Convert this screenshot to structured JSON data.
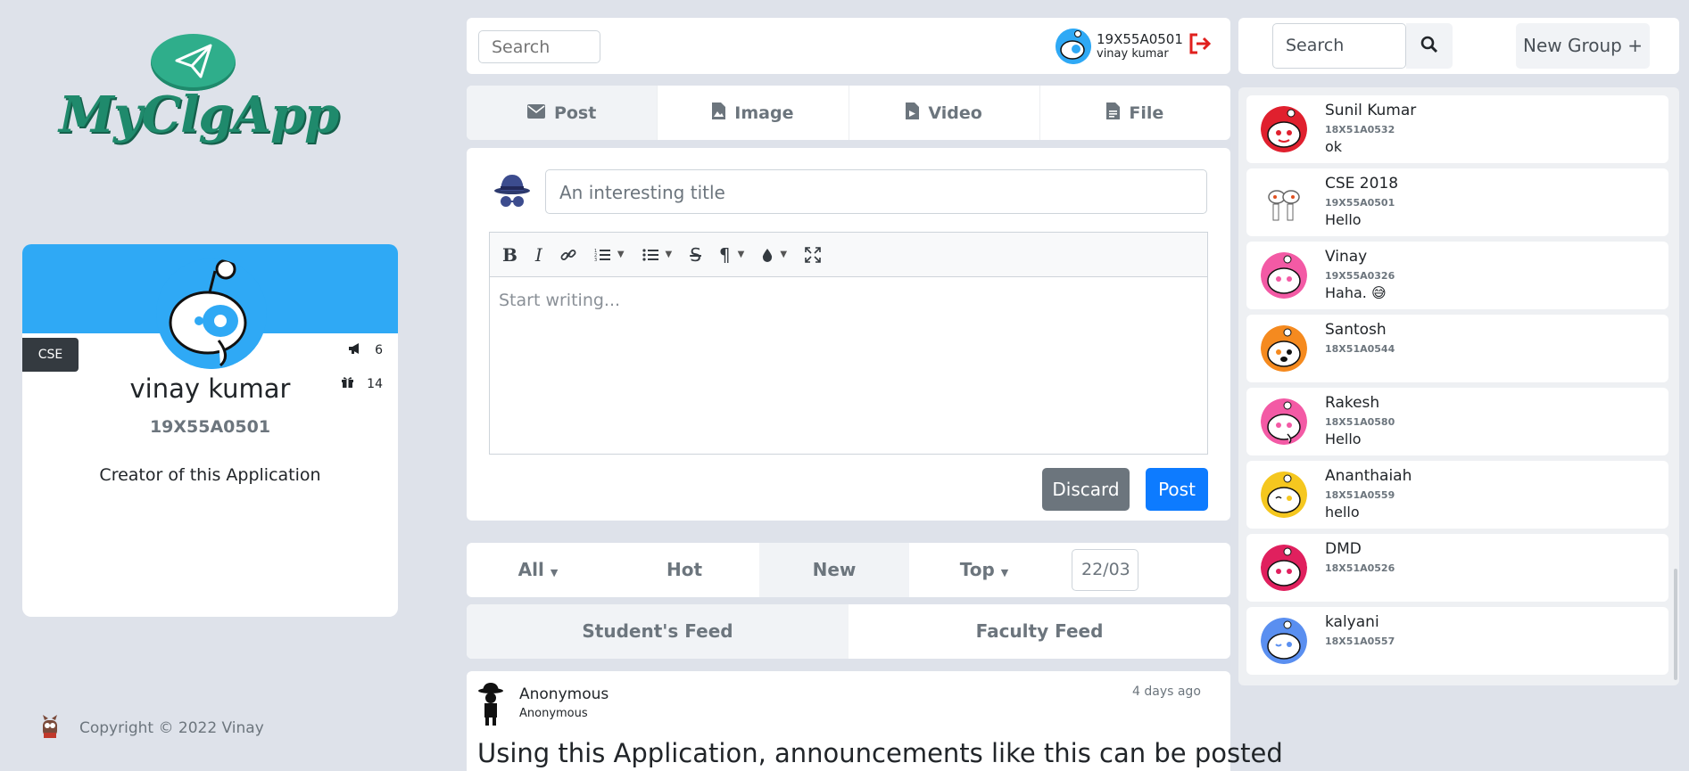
{
  "app": {
    "logo_text": "MyClgApp",
    "brand_color": "#1f8a6c",
    "accent": "#2fa9f5",
    "primary": "#0d7bff"
  },
  "profile": {
    "dept": "CSE",
    "stat_announcements": "6",
    "stat_gifts": "14",
    "name": "vinay kumar",
    "id": "19X55A0501",
    "bio": "Creator of this Application"
  },
  "footer": {
    "copyright": "Copyright © 2022 Vinay"
  },
  "topbar": {
    "search_placeholder": "Search",
    "user_id": "19X55A0501",
    "user_name": "vinay kumar"
  },
  "post_tabs": [
    {
      "label": "Post",
      "icon": "envelope-icon"
    },
    {
      "label": "Image",
      "icon": "image-file-icon"
    },
    {
      "label": "Video",
      "icon": "video-file-icon"
    },
    {
      "label": "File",
      "icon": "file-icon"
    }
  ],
  "composer": {
    "title_placeholder": "An interesting title",
    "body_placeholder": "Start writing...",
    "discard_label": "Discard",
    "post_label": "Post"
  },
  "sort": {
    "all": "All",
    "hot": "Hot",
    "new": "New",
    "top": "Top",
    "date": "22/03"
  },
  "feeds": {
    "students": "Student's Feed",
    "faculty": "Faculty Feed"
  },
  "post": {
    "author": "Anonymous",
    "author_sub": "Anonymous",
    "time": "4 days ago",
    "body": "Using this Application, announcements like this can be posted"
  },
  "right_top": {
    "search_placeholder": "Search",
    "new_group": "New Group +"
  },
  "chats": [
    {
      "name": "Sunil Kumar",
      "id": "18X51A0532",
      "msg": "ok",
      "color": "#e0202e"
    },
    {
      "name": "CSE 2018",
      "id": "19X55A0501",
      "msg": "Hello",
      "color": "#ffffff"
    },
    {
      "name": "Vinay",
      "id": "19X55A0326",
      "msg": "Haha. 😅",
      "color": "#f35aa5"
    },
    {
      "name": "Santosh",
      "id": "18X51A0544",
      "msg": "",
      "color": "#f58a1f"
    },
    {
      "name": "Rakesh",
      "id": "18X51A0580",
      "msg": "Hello",
      "color": "#f35aa5"
    },
    {
      "name": "Ananthaiah",
      "id": "18X51A0559",
      "msg": "hello",
      "color": "#f5c71f"
    },
    {
      "name": "DMD",
      "id": "18X51A0526",
      "msg": "",
      "color": "#e0205e"
    },
    {
      "name": "kalyani",
      "id": "18X51A0557",
      "msg": "",
      "color": "#5a8ff0"
    }
  ]
}
